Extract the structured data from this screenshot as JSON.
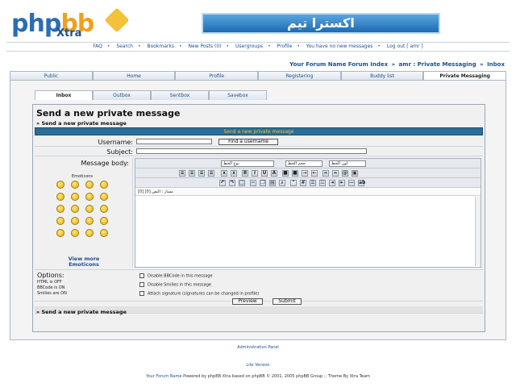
{
  "header": {
    "logo_text": "php",
    "logo_text2": "bb",
    "logo_sub": "Xtra",
    "banner_text": "اكسترا تيم"
  },
  "topnav": [
    "FAQ",
    "Search",
    "Bookmarks",
    "New Posts (0)",
    "Usergroups",
    "Profile",
    "You have no new messages",
    "Log out [ amr ]"
  ],
  "breadcrumb": {
    "forum": "Your Forum Name Forum Index",
    "sep1": "»",
    "pm": "amr : Private Messaging",
    "sep2": "»",
    "current": "Inbox"
  },
  "main_tabs": [
    "Public",
    "Home",
    "Profile",
    "Registering",
    "Buddy list",
    "Private Messaging"
  ],
  "sub_tabs": [
    "Inbox",
    "Outbox",
    "Sentbox",
    "Savebox"
  ],
  "form": {
    "title": "Send a new private message",
    "subtitle": "» Send a new private message",
    "header_bar": "Send a new private message",
    "username_label": "Username:",
    "find_button": "Find a username",
    "subject_label": "Subject:",
    "body_label": "Message body:",
    "emoticons_title": "Emoticons",
    "view_more": "View more Emoticons",
    "toolbar_selects": [
      "لون الخط",
      "حجم الخط",
      "نوع الخط"
    ],
    "path_text": "مسار : النص [0] [0]",
    "options_title": "Options:",
    "html_status": "HTML is OFF",
    "bbcode_status": "BBCode is ON",
    "smilies_status": "Smilies are ON",
    "checkbox_1": "Disable BBCode in this message",
    "checkbox_2": "Disable Smilies in this message",
    "checkbox_3": "Attach signature (signatures can be changed in profile)",
    "preview_button": "Preview",
    "submit_button": "Submit",
    "footer_subtitle": "» Send a new private message"
  },
  "footer": {
    "admin_panel": "Administration Panel",
    "lite_version": "Lite Version",
    "forum_name": "Your Forum Name",
    "powered_by": "Powered by phpBB Xtra based on phpBB © 2001, 2005 phpBB Group :: Theme By Xtra Team"
  }
}
